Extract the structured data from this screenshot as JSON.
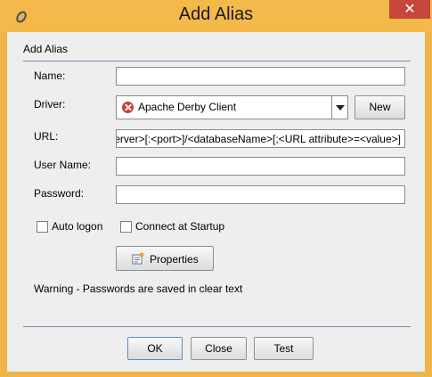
{
  "window": {
    "title": "Add Alias",
    "close_glyph": "✕"
  },
  "section": {
    "title": "Add Alias"
  },
  "form": {
    "name_label": "Name:",
    "name_value": "",
    "driver_label": "Driver:",
    "driver_value": "Apache Derby Client",
    "new_button": "New",
    "url_label": "URL:",
    "url_value": "erver>[:<port>]/<databaseName>[;<URL attribute>=<value>]",
    "username_label": "User Name:",
    "username_value": "",
    "password_label": "Password:",
    "password_value": "",
    "auto_logon_label": "Auto logon",
    "auto_logon_checked": false,
    "connect_startup_label": "Connect at Startup",
    "connect_startup_checked": false,
    "properties_button": "Properties",
    "warning_text": "Warning - Passwords are saved in clear text"
  },
  "buttons": {
    "ok": "OK",
    "close": "Close",
    "test": "Test"
  },
  "icons": {
    "app": "bean-icon",
    "driver_status": "error-icon",
    "properties": "properties-icon"
  }
}
